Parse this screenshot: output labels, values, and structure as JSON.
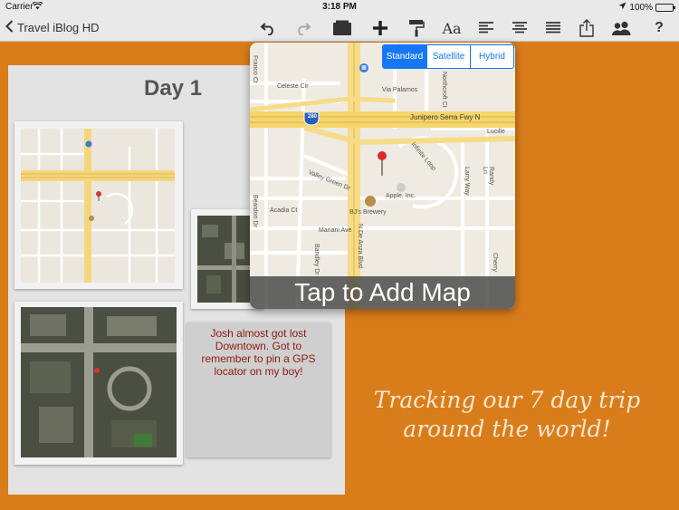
{
  "status_bar": {
    "carrier": "Carrier",
    "time": "3:18 PM",
    "battery": "100%",
    "battery_level": 1.0
  },
  "toolbar": {
    "back_label": "Travel iBlog HD",
    "icons": [
      "undo-icon",
      "redo-icon",
      "card-icon",
      "add-icon",
      "paint-roller-icon",
      "font-icon",
      "align-left-icon",
      "align-center-icon",
      "justify-icon",
      "share-icon",
      "people-icon",
      "help-icon"
    ]
  },
  "page": {
    "day_title": "Day 1",
    "note_text": "Josh almost got lost Downtown. Got to remember to pin a GPS locator on my boy!"
  },
  "map_popover": {
    "map_types": [
      "Standard",
      "Satellite",
      "Hybrid"
    ],
    "selected_map_type": "Standard",
    "labels": {
      "franco": "Franco Ct",
      "celeste": "Celeste Cir",
      "palamos": "Via Palamos",
      "northcroft": "Northcroft Ct",
      "highway": "Junipero Serra Fwy N",
      "shield": "280",
      "lucille": "Lucille",
      "infinite": "Infinite Loop",
      "valley_green": "Valley Green Dr",
      "larry": "Larry Way",
      "randy": "Randy Ln",
      "beardon": "Beardon Dr",
      "acadia": "Acadia Ct",
      "apple": "Apple, Inc.",
      "bjs": "BJ's Brewery",
      "mariani": "Mariani Ave",
      "bandley": "Bandley Dr",
      "de_anza": "N De Anza Blvd",
      "chery": "Cherry"
    },
    "tap_label": "Tap to Add Map"
  },
  "tagline": "Tracking our 7 day trip around the world!"
}
